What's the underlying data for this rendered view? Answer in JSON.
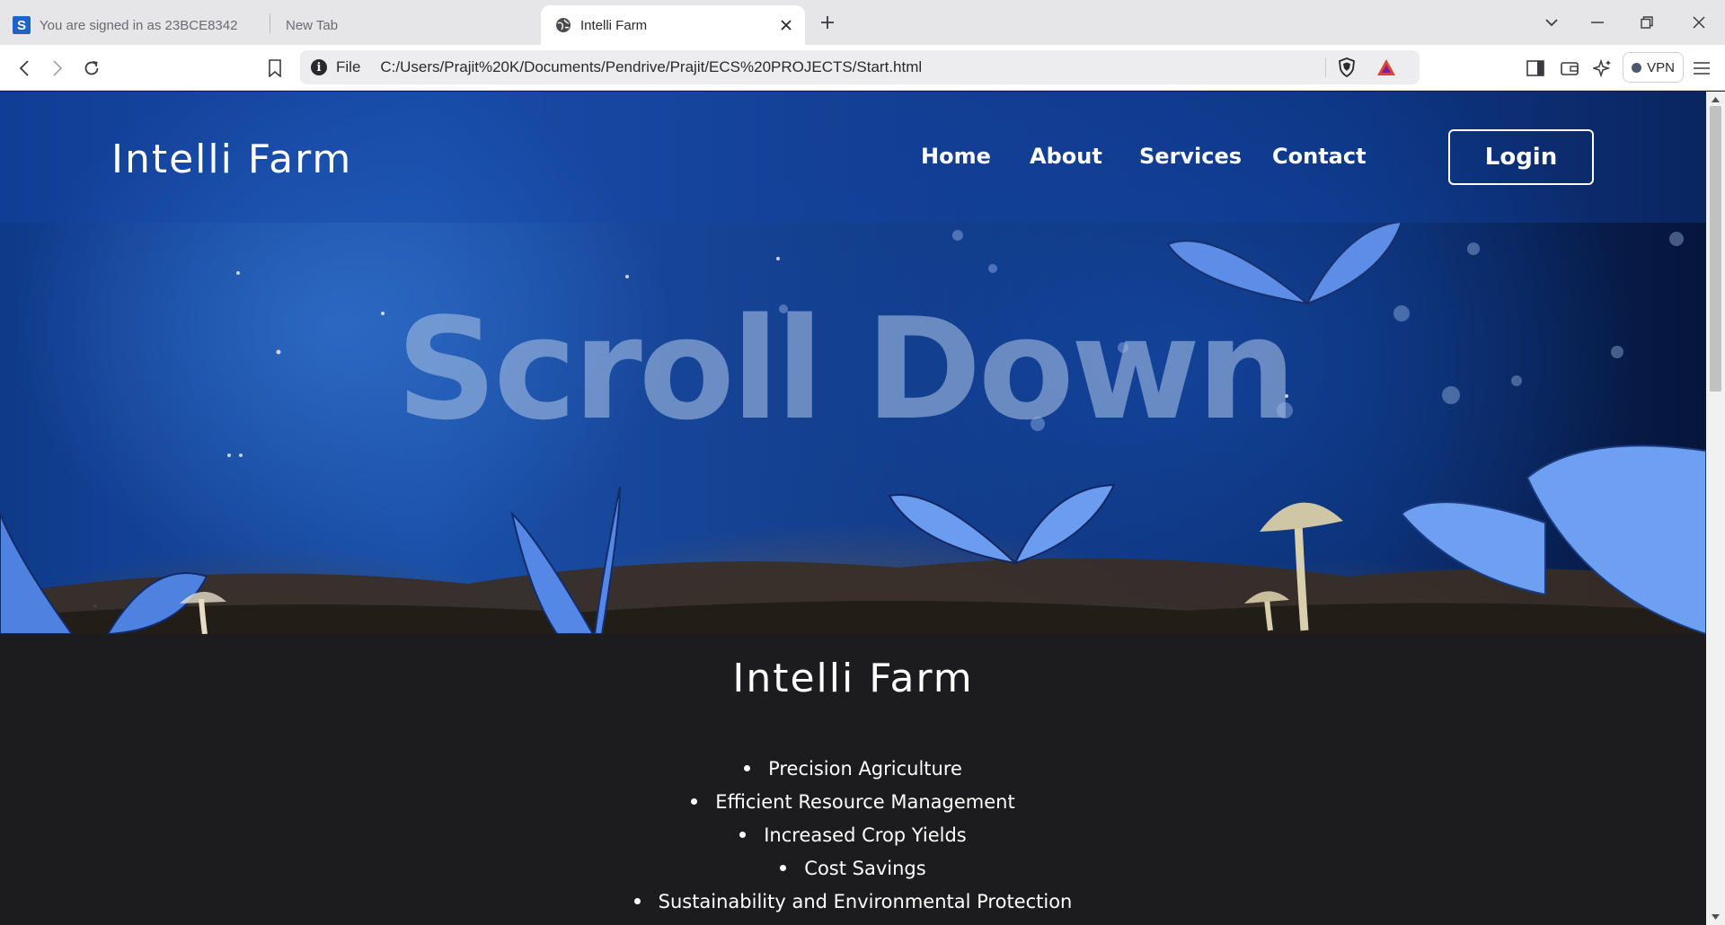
{
  "browser": {
    "tabs": [
      {
        "title": "You are signed in as 23BCE8342",
        "favicon": "S"
      },
      {
        "title": "New Tab"
      },
      {
        "title": "Intelli Farm",
        "active": true
      }
    ],
    "toolbar": {
      "scheme_label": "File",
      "url": "C:/Users/Prajit%20K/Documents/Pendrive/Prajit/ECS%20PROJECTS/Start.html",
      "vpn_label": "VPN"
    }
  },
  "page": {
    "brand": "Intelli Farm",
    "nav": [
      "Home",
      "About",
      "Services",
      "Contact"
    ],
    "login_label": "Login",
    "hero_text": "Scroll Down",
    "section_title": "Intelli Farm",
    "features": [
      "Precision Agriculture",
      "Efficient Resource Management",
      "Increased Crop Yields",
      "Cost Savings",
      "Sustainability and Environmental Protection"
    ]
  },
  "colors": {
    "hero_blue": "#1a4fa8",
    "page_bg": "#1c1c1e",
    "accent_brave": "#e0452b"
  }
}
